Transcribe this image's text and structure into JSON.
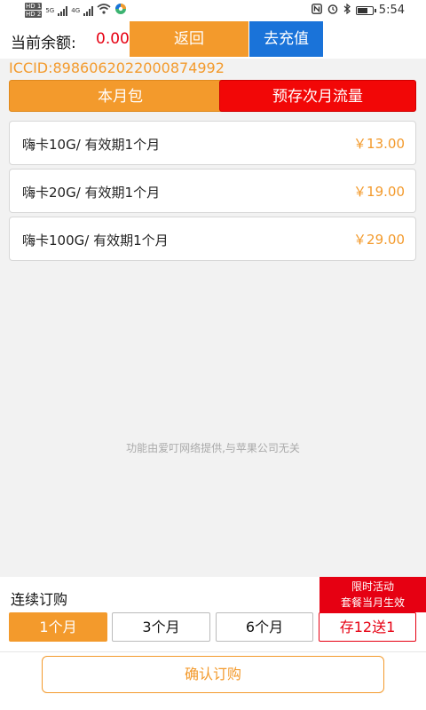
{
  "status_bar": {
    "time": "5:54",
    "tag_top": "HD 1",
    "tag_bottom": "HD 2",
    "net_1": "5G",
    "net_2": "4G",
    "battery_level": 0.65,
    "icons": [
      "signal-icon",
      "wifi-icon",
      "app-icon",
      "nfc-icon",
      "alarm-icon",
      "bluetooth-icon",
      "battery-icon"
    ]
  },
  "header": {
    "balance_label": "当前余额:",
    "balance_value": "0.00",
    "back_label": "返回",
    "recharge_label": "去充值"
  },
  "iccid": "ICCID:8986062022000874992",
  "tabs": {
    "current_month": "本月包",
    "next_month": "预存次月流量"
  },
  "plans": [
    {
      "name": "嗨卡10G/ 有效期1个月",
      "price": "￥13.00"
    },
    {
      "name": "嗨卡20G/ 有效期1个月",
      "price": "￥19.00"
    },
    {
      "name": "嗨卡100G/ 有效期1个月",
      "price": "￥29.00"
    }
  ],
  "footer_note": "功能由爱叮网络提供,与苹果公司无关",
  "subscription": {
    "label": "连续订购",
    "promo_line1": "限时活动",
    "promo_line2": "套餐当月生效",
    "options": [
      "1个月",
      "3个月",
      "6个月",
      "存12送1"
    ],
    "selected_index": 0,
    "confirm_label": "确认订购"
  },
  "colors": {
    "accent_orange": "#f39a2c",
    "accent_red": "#e60012",
    "accent_blue": "#1a73d9",
    "background": "#f2f2f2"
  }
}
